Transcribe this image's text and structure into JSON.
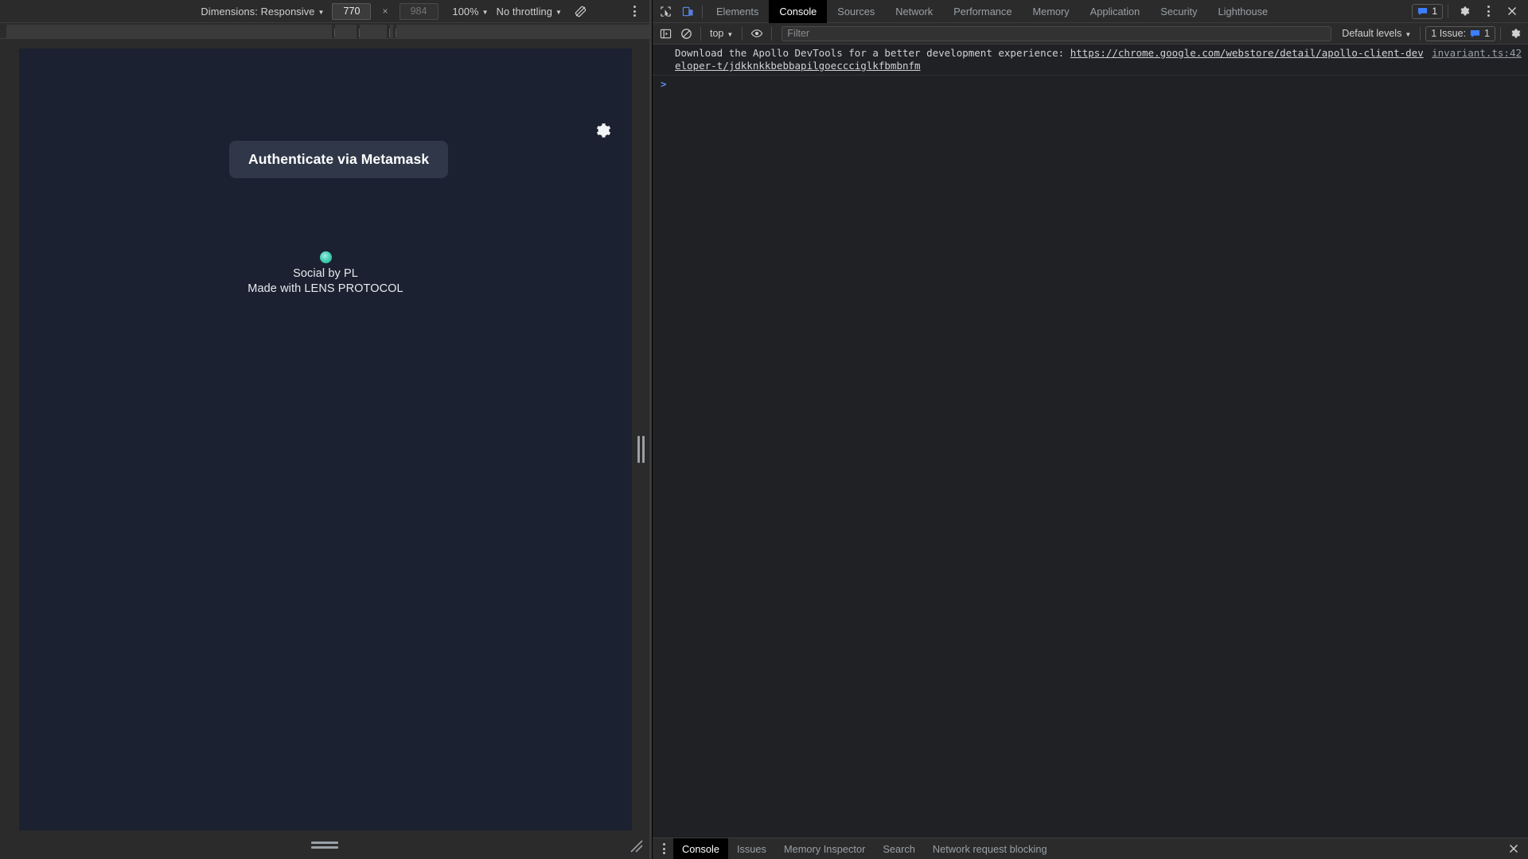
{
  "device_toolbar": {
    "dimensions_label": "Dimensions: Responsive",
    "width_value": "770",
    "height_placeholder": "984",
    "multiply": "×",
    "zoom_label": "100%",
    "throttling_label": "No throttling",
    "rotate_icon": "rotate-device-icon",
    "more_icon": "more-options-icon"
  },
  "page": {
    "auth_button_label": "Authenticate via Metamask",
    "settings_icon": "gear-icon",
    "brand_icon": "lens-protocol-logo-icon",
    "brand_line_1": "Social by PL",
    "brand_line_2": "Made with LENS PROTOCOL",
    "background_color": "#1b2130",
    "button_color": "#2f3748",
    "brand_accent_color": "#35cdb0"
  },
  "devtools": {
    "inspect_icon": "inspect-element-icon",
    "device_toggle_icon": "device-toolbar-icon",
    "tabs": [
      {
        "label": "Elements",
        "active": false
      },
      {
        "label": "Console",
        "active": true
      },
      {
        "label": "Sources",
        "active": false
      },
      {
        "label": "Network",
        "active": false
      },
      {
        "label": "Performance",
        "active": false
      },
      {
        "label": "Memory",
        "active": false
      },
      {
        "label": "Application",
        "active": false
      },
      {
        "label": "Security",
        "active": false
      },
      {
        "label": "Lighthouse",
        "active": false
      }
    ],
    "issues_badge_count": "1",
    "settings_icon": "gear-icon",
    "more_icon": "more-tools-icon",
    "close_icon": "close-icon",
    "console_toolbar": {
      "sidebar_icon": "console-sidebar-icon",
      "clear_icon": "clear-console-icon",
      "context_label": "top",
      "eye_icon": "live-expressions-eye-icon",
      "filter_placeholder": "Filter",
      "filter_value": "",
      "levels_label": "Default levels",
      "issues_label": "1 Issue:",
      "issues_count": "1",
      "settings_icon": "console-settings-gear-icon"
    },
    "messages": [
      {
        "text_before": "Download the Apollo DevTools for a better development experience: ",
        "link": "https://chrome.google.com/webstore/detail/apollo-client-developer-t/jdkknkkbebbapilgoeccciglkfbmbnfm",
        "source": "invariant.ts:42"
      }
    ],
    "prompt_symbol": ">",
    "drawer": {
      "more_icon": "drawer-more-icon",
      "tabs": [
        {
          "label": "Console",
          "active": true
        },
        {
          "label": "Issues",
          "active": false
        },
        {
          "label": "Memory Inspector",
          "active": false
        },
        {
          "label": "Search",
          "active": false
        },
        {
          "label": "Network request blocking",
          "active": false
        }
      ],
      "close_icon": "close-drawer-icon"
    }
  }
}
